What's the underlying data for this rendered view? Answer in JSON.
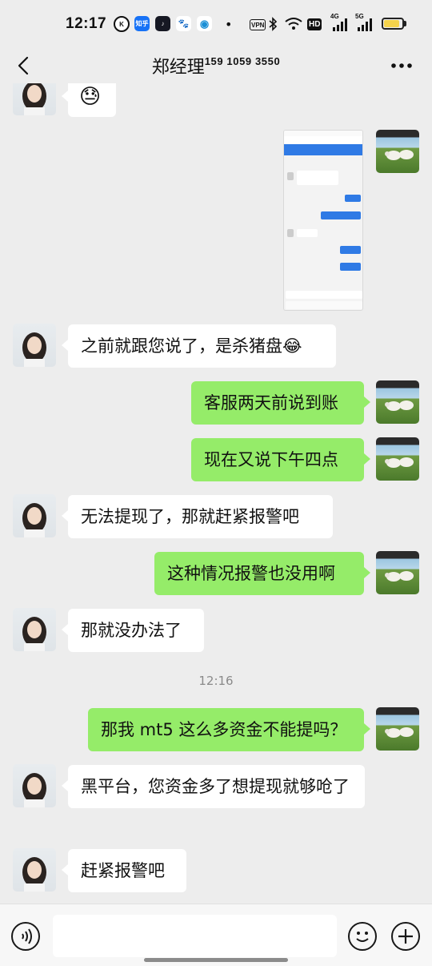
{
  "status_bar": {
    "time": "12:17",
    "apps": [
      {
        "name": "k-app-icon",
        "label": "K",
        "color": "#111111"
      },
      {
        "name": "zhihu-icon",
        "label": "知乎",
        "color": "#1772f6"
      },
      {
        "name": "douyin-icon",
        "label": "♪",
        "color": "#161823"
      },
      {
        "name": "baidu-icon",
        "label": "🐾",
        "color": "#ffffff"
      },
      {
        "name": "browser-icon",
        "label": "◉",
        "color": "#ffffff"
      }
    ],
    "dot": "•",
    "vpn": "VPN",
    "hd": "HD",
    "net1": "4G",
    "net2": "5G"
  },
  "nav": {
    "title_name": "郑经理",
    "title_phone": "159 1059 3550",
    "back_icon": "chevron-left-icon",
    "more_icon": "more-icon"
  },
  "messages": [
    {
      "side": "in",
      "type": "emoji",
      "text": "😓"
    },
    {
      "side": "out",
      "type": "image",
      "caption": "screenshot"
    },
    {
      "side": "in",
      "type": "text",
      "text": "之前就跟您说了，是杀猪盘😂"
    },
    {
      "side": "out",
      "type": "text",
      "text": "客服两天前说到账"
    },
    {
      "side": "out",
      "type": "text",
      "text": "现在又说下午四点"
    },
    {
      "side": "in",
      "type": "text",
      "text": "无法提现了，那就赶紧报警吧"
    },
    {
      "side": "out",
      "type": "text",
      "text": "这种情况报警也没用啊"
    },
    {
      "side": "in",
      "type": "text",
      "text": "那就没办法了"
    },
    {
      "side": "out",
      "type": "text",
      "text": "那我 mt5 这么多资金不能提吗？"
    },
    {
      "side": "in",
      "type": "text",
      "text": "黑平台，您资金多了想提现就够呛了"
    },
    {
      "side": "in",
      "type": "text",
      "text": "赶紧报警吧"
    }
  ],
  "timestamp": "12:16",
  "input": {
    "value": "",
    "placeholder": ""
  },
  "colors": {
    "background": "#ededed",
    "bubble_out": "#95ec69",
    "bubble_in": "#ffffff"
  }
}
